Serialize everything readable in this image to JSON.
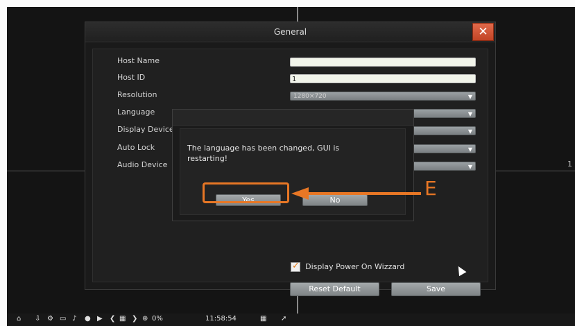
{
  "window": {
    "title": "General",
    "close_glyph": "✕"
  },
  "form": {
    "labels": {
      "host_name": "Host Name",
      "host_id": "Host ID",
      "resolution": "Resolution",
      "language": "Language",
      "display_device": "Display Device",
      "auto_lock": "Auto Lock",
      "audio_device": "Audio Device"
    },
    "host_name_value": "",
    "host_id_value": "1",
    "resolution_value": "1280×720",
    "dropdown_caret": "▼",
    "checkbox_label": "Display Power On Wizzard",
    "checkbox_checked": true,
    "reset_label": "Reset Default",
    "save_label": "Save"
  },
  "dialog": {
    "message": "The language has been changed, GUI is restarting!",
    "yes_label": "Yes",
    "no_label": "No"
  },
  "annotation": {
    "letter": "E",
    "color": "#e87725"
  },
  "taskbar": {
    "percent": "0%",
    "time": "11:58:54"
  },
  "colors": {
    "close_button": "#c24425",
    "panel_bg": "#1a1a1a"
  }
}
